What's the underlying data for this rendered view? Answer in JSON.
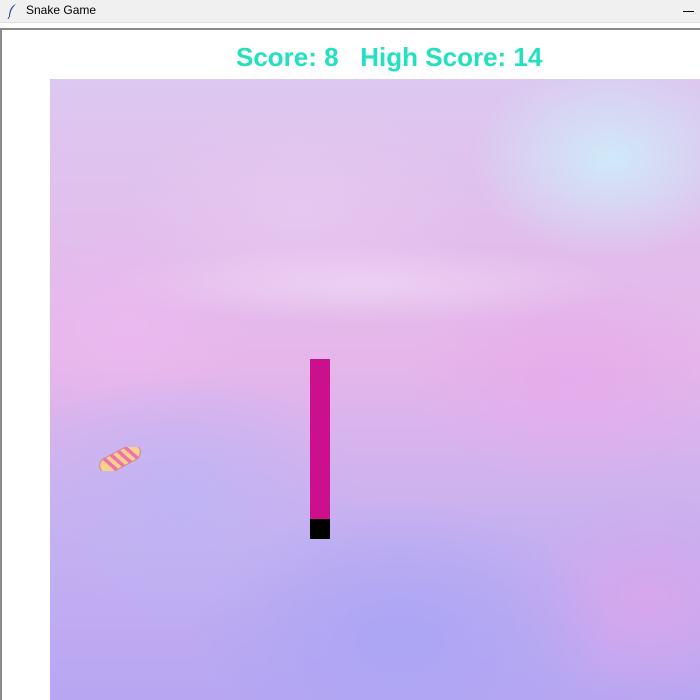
{
  "window": {
    "title": "Snake Game",
    "app_icon": "feather-icon",
    "minimize_icon": "minimize-icon"
  },
  "hud": {
    "score_label": "Score:",
    "score": 8,
    "high_score_label": "High Score:",
    "high_score": 14,
    "text": "Score: 8   High Score: 14",
    "color": "#22e0c0"
  },
  "game": {
    "background": "pastel pink-purple watercolor",
    "snake": {
      "body_color": "#cc0f8c",
      "head_color": "#000000",
      "length": 9,
      "direction": "down"
    },
    "food": {
      "type": "candy",
      "icon": "candy-icon",
      "colors": [
        "#f7d28a",
        "#ef6fb0"
      ]
    }
  }
}
